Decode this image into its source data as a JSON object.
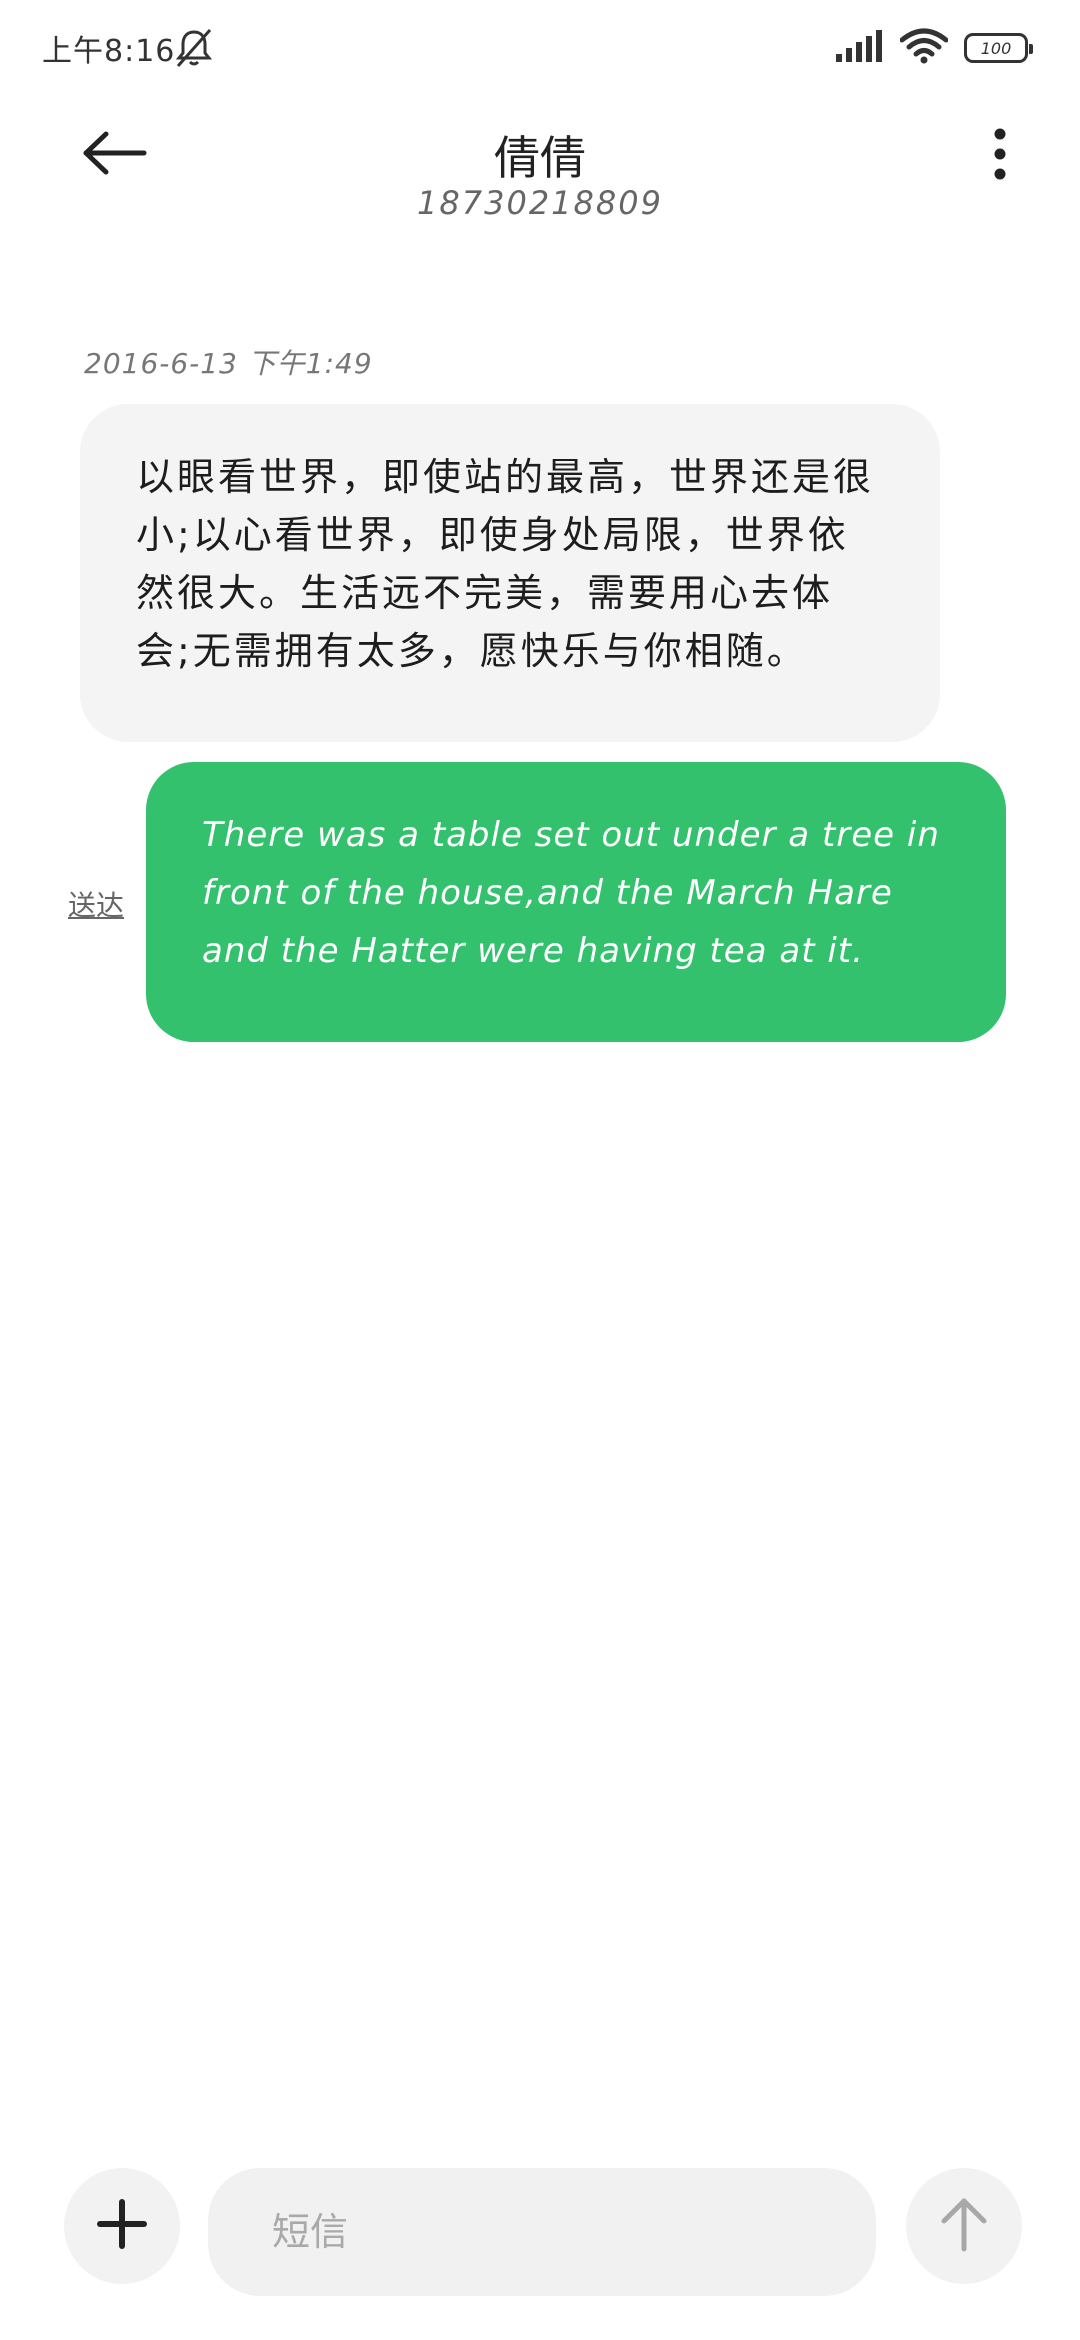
{
  "status_bar": {
    "time": "上午8:16",
    "battery": "100",
    "icons": [
      "dnd-bell-off-icon",
      "signal-icon",
      "wifi-icon",
      "battery-icon"
    ]
  },
  "header": {
    "contact_name": "倩倩",
    "contact_number": "18730218809",
    "icons": [
      "back-arrow-icon",
      "more-vert-icon"
    ]
  },
  "conversation": {
    "timestamp": "2016-6-13 下午1:49",
    "incoming": {
      "text": "以眼看世界，即使站的最高，世界还是很小;以心看世界，即使身处局限，世界依然很大。生活远不完美，需要用心去体会;无需拥有太多，愿快乐与你相随。"
    },
    "outgoing": {
      "text": "There was a table set out under a tree in front of the house,and the March Hare and the Hatter were having tea at it.",
      "status": "送达"
    }
  },
  "composer": {
    "placeholder": "短信",
    "icons": [
      "plus-icon",
      "send-arrow-up-icon"
    ]
  },
  "colors": {
    "outgoing_bubble": "#33c16e",
    "incoming_bubble": "#f4f4f4",
    "background": "#ffffff"
  }
}
